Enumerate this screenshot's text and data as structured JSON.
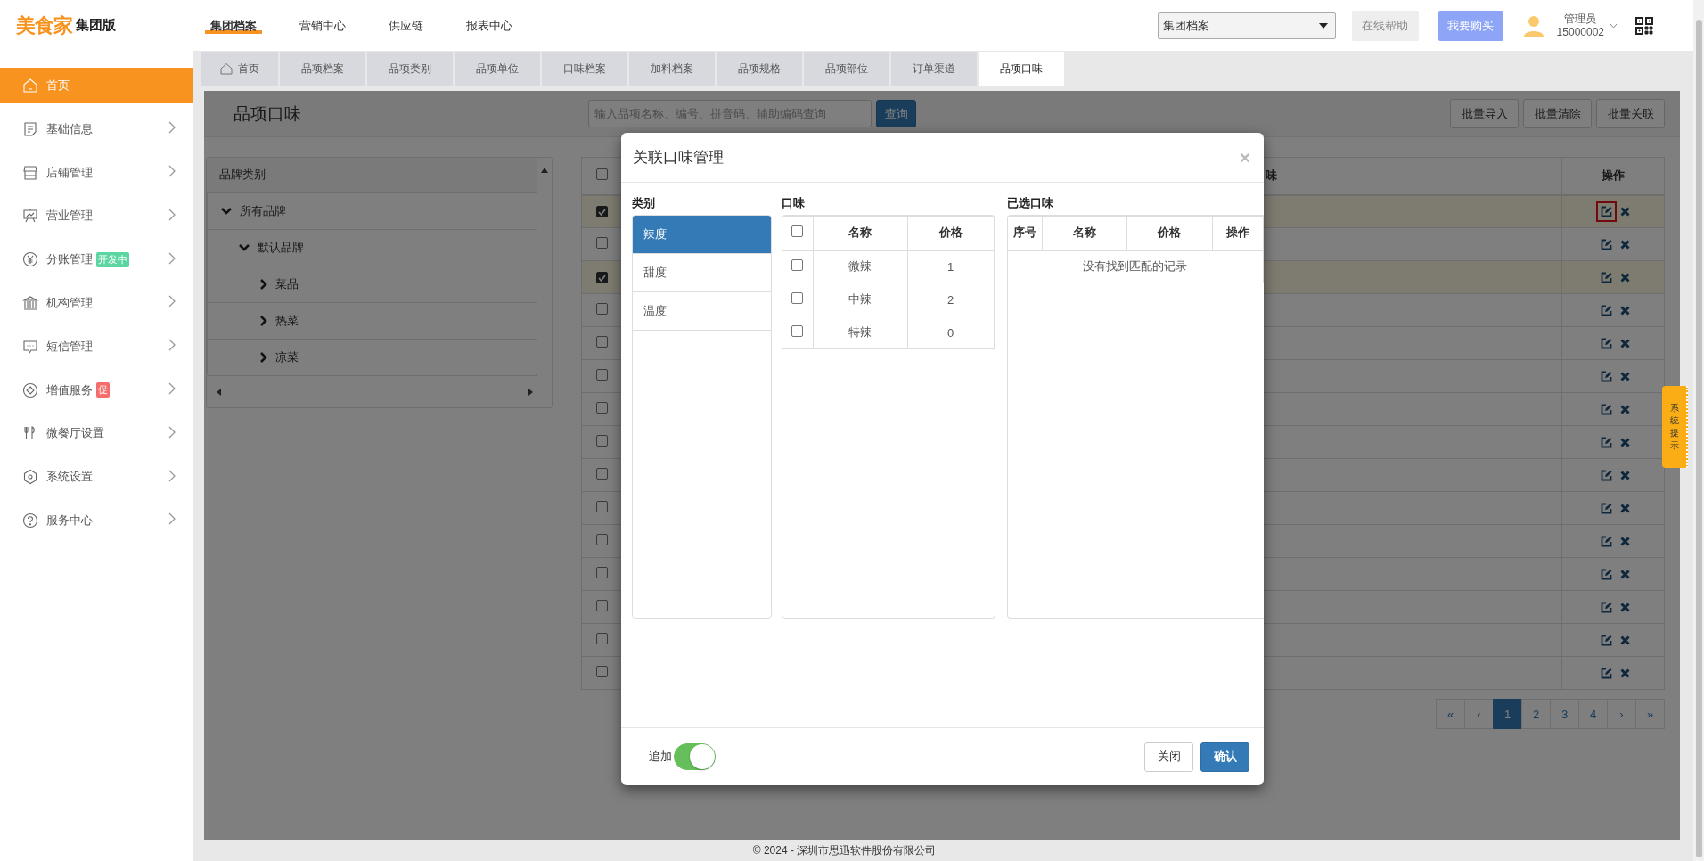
{
  "header": {
    "logo": "美食家",
    "edition": "集团版",
    "nav": [
      {
        "label": "集团档案",
        "selected": true
      },
      {
        "label": "营销中心",
        "selected": false
      },
      {
        "label": "供应链",
        "selected": false
      },
      {
        "label": "报表中心",
        "selected": false
      }
    ],
    "org_select": "集团档案",
    "help_button": "在线帮助",
    "buy_button": "我要购买",
    "user": {
      "name": "管理员",
      "id": "15000002"
    }
  },
  "sidebar": {
    "items": [
      {
        "label": "首页",
        "selected": true,
        "expandable": false
      },
      {
        "label": "基础信息",
        "selected": false,
        "expandable": true
      },
      {
        "label": "店铺管理",
        "selected": false,
        "expandable": true
      },
      {
        "label": "营业管理",
        "selected": false,
        "expandable": true
      },
      {
        "label": "分账管理",
        "selected": false,
        "expandable": true,
        "badge": {
          "text": "开发中",
          "color": "#5cd6a0"
        }
      },
      {
        "label": "机构管理",
        "selected": false,
        "expandable": true
      },
      {
        "label": "短信管理",
        "selected": false,
        "expandable": true
      },
      {
        "label": "增值服务",
        "selected": false,
        "expandable": true,
        "badge": {
          "text": "促",
          "color": "#f56c6c"
        }
      },
      {
        "label": "微餐厅设置",
        "selected": false,
        "expandable": true
      },
      {
        "label": "系统设置",
        "selected": false,
        "expandable": true
      },
      {
        "label": "服务中心",
        "selected": false,
        "expandable": true
      }
    ]
  },
  "tabs": [
    {
      "label": "首页",
      "selected": false
    },
    {
      "label": "品项档案",
      "selected": false
    },
    {
      "label": "品项类别",
      "selected": false
    },
    {
      "label": "品项单位",
      "selected": false
    },
    {
      "label": "口味档案",
      "selected": false
    },
    {
      "label": "加料档案",
      "selected": false
    },
    {
      "label": "品项规格",
      "selected": false
    },
    {
      "label": "品项部位",
      "selected": false
    },
    {
      "label": "订单渠道",
      "selected": false
    },
    {
      "label": "品项口味",
      "selected": true
    }
  ],
  "page": {
    "title": "品项口味",
    "search": {
      "placeholder": "输入品项名称、编号、拼音码、辅助编码查询"
    },
    "search_button": "查询",
    "actions": [
      "批量导入",
      "批量清除",
      "批量关联"
    ],
    "tree": {
      "header": "品牌类别",
      "nodes": [
        {
          "label": "所有品牌",
          "expanded": true,
          "children": [
            {
              "label": "默认品牌",
              "expanded": true,
              "children": [
                {
                  "label": "菜品",
                  "expanded": false
                },
                {
                  "label": "热菜",
                  "expanded": false
                },
                {
                  "label": "凉菜",
                  "expanded": false
                }
              ]
            }
          ]
        }
      ]
    },
    "table": {
      "header_checked": false,
      "columns": {
        "column_3": "味",
        "actions": "操作"
      },
      "rows": [
        {
          "checked": true,
          "annotated": true
        },
        {
          "checked": false,
          "annotated": false
        },
        {
          "checked": true,
          "annotated": false
        },
        {
          "checked": false,
          "annotated": false
        },
        {
          "checked": false,
          "annotated": false
        },
        {
          "checked": false,
          "annotated": false
        },
        {
          "checked": false,
          "annotated": false
        },
        {
          "checked": false,
          "annotated": false
        },
        {
          "checked": false,
          "annotated": false
        },
        {
          "checked": false,
          "annotated": false
        },
        {
          "checked": false,
          "annotated": false
        },
        {
          "checked": false,
          "annotated": false
        },
        {
          "checked": false,
          "annotated": false
        },
        {
          "checked": false,
          "annotated": false
        },
        {
          "checked": false,
          "annotated": false
        }
      ]
    },
    "pagination": {
      "first": "«",
      "prev": "‹",
      "pages": [
        {
          "label": "1",
          "selected": true
        },
        {
          "label": "2",
          "selected": false
        },
        {
          "label": "3",
          "selected": false
        },
        {
          "label": "4",
          "selected": false
        }
      ],
      "next": "›",
      "last": "»"
    }
  },
  "modal": {
    "title": "关联口味管理",
    "close": "×",
    "category_heading": "类别",
    "categories": [
      {
        "label": "辣度",
        "selected": true
      },
      {
        "label": "甜度",
        "selected": false
      },
      {
        "label": "温度",
        "selected": false
      }
    ],
    "flavor_heading": "口味",
    "all_checked": false,
    "flavor_columns": [
      "名称",
      "价格"
    ],
    "flavors": [
      {
        "name": "微辣",
        "price": "1",
        "checked": false
      },
      {
        "name": "中辣",
        "price": "2",
        "checked": false
      },
      {
        "name": "特辣",
        "price": "0",
        "checked": false
      }
    ],
    "selected_heading": "已选口味",
    "selected_columns": [
      "序号",
      "名称",
      "价格",
      "操作"
    ],
    "empty_text": "没有找到匹配的记录",
    "append_label": "追加",
    "append_on": true,
    "close_button": "关闭",
    "confirm_button": "确认"
  },
  "system_tip": "系统提示",
  "footer": "© 2024 - 深圳市思迅软件股份有限公司"
}
